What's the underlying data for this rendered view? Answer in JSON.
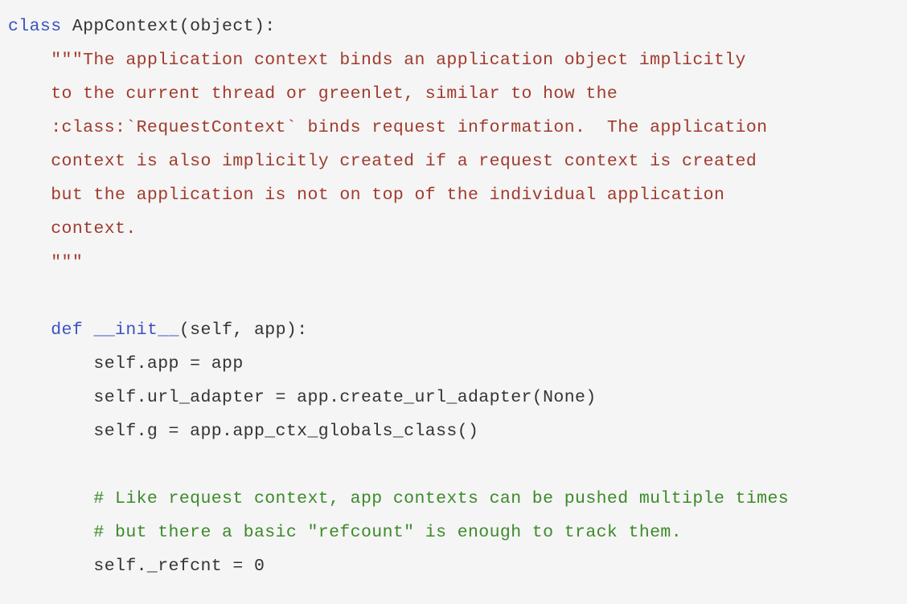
{
  "colors": {
    "background": "#f5f5f5",
    "keyword": "#3b52c4",
    "string": "#a03b2d",
    "comment": "#3c8a2a",
    "text": "#333333"
  },
  "code": {
    "lines": [
      [
        {
          "t": "kw",
          "v": "class"
        },
        {
          "t": "txt",
          "v": " AppContext(object):"
        }
      ],
      [
        {
          "t": "txt",
          "v": "    "
        },
        {
          "t": "str",
          "v": "\"\"\"The application context binds an application object implicitly"
        }
      ],
      [
        {
          "t": "str",
          "v": "    to the current thread or greenlet, similar to how the"
        }
      ],
      [
        {
          "t": "str",
          "v": "    :class:`RequestContext` binds request information.  The application"
        }
      ],
      [
        {
          "t": "str",
          "v": "    context is also implicitly created if a request context is created"
        }
      ],
      [
        {
          "t": "str",
          "v": "    but the application is not on top of the individual application"
        }
      ],
      [
        {
          "t": "str",
          "v": "    context."
        }
      ],
      [
        {
          "t": "str",
          "v": "    \"\"\""
        }
      ],
      [
        {
          "t": "txt",
          "v": ""
        }
      ],
      [
        {
          "t": "txt",
          "v": "    "
        },
        {
          "t": "kw",
          "v": "def"
        },
        {
          "t": "txt",
          "v": " "
        },
        {
          "t": "kw",
          "v": "__init__"
        },
        {
          "t": "txt",
          "v": "(self, app):"
        }
      ],
      [
        {
          "t": "txt",
          "v": "        self.app = app"
        }
      ],
      [
        {
          "t": "txt",
          "v": "        self.url_adapter = app.create_url_adapter(None)"
        }
      ],
      [
        {
          "t": "txt",
          "v": "        self.g = app.app_ctx_globals_class()"
        }
      ],
      [
        {
          "t": "txt",
          "v": ""
        }
      ],
      [
        {
          "t": "txt",
          "v": "        "
        },
        {
          "t": "cm",
          "v": "# Like request context, app contexts can be pushed multiple times"
        }
      ],
      [
        {
          "t": "txt",
          "v": "        "
        },
        {
          "t": "cm",
          "v": "# but there a basic \"refcount\" is enough to track them."
        }
      ],
      [
        {
          "t": "txt",
          "v": "        self._refcnt = 0"
        }
      ]
    ]
  }
}
